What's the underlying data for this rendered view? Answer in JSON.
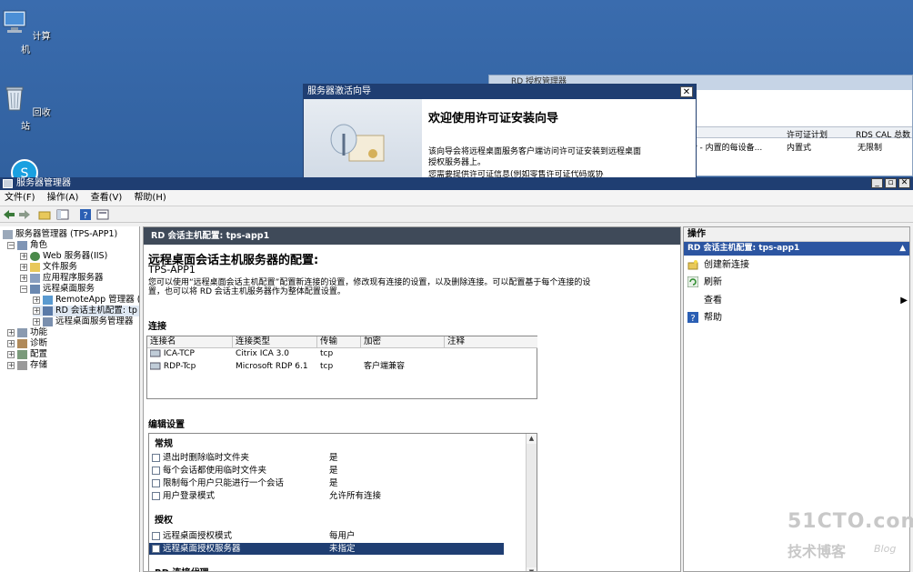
{
  "desktop": {
    "icons": [
      {
        "label": "计算机"
      },
      {
        "label": "回收站"
      }
    ]
  },
  "bg_window": {
    "title": "RD 授权管理器",
    "columns": [
      "许可证计划",
      "RDS CAL 总数"
    ],
    "row": {
      "product": "r - 内置的每设备...",
      "plan": "内置式",
      "total": "无限制"
    }
  },
  "wizard": {
    "title": "服务器激活向导",
    "heading": "欢迎使用许可证安装向导",
    "text": "该向导会将远程桌面服务客户端访问许可证安装到远程桌面授权服务器上。",
    "text2": "您需要提供许可证信息(例如零售许可证代码或协"
  },
  "main": {
    "title": "服务器管理器",
    "menu": [
      "文件(F)",
      "操作(A)",
      "查看(V)",
      "帮助(H)"
    ],
    "tree": [
      {
        "label": "服务器管理器 (TPS-APP1)",
        "indent": 0,
        "exp": ""
      },
      {
        "label": "角色",
        "indent": 1,
        "exp": "−"
      },
      {
        "label": "Web 服务器(IIS)",
        "indent": 2,
        "exp": "+"
      },
      {
        "label": "文件服务",
        "indent": 2,
        "exp": "+"
      },
      {
        "label": "应用程序服务器",
        "indent": 2,
        "exp": "+"
      },
      {
        "label": "远程桌面服务",
        "indent": 2,
        "exp": "−"
      },
      {
        "label": "RemoteApp 管理器 (",
        "indent": 3,
        "exp": "+"
      },
      {
        "label": "RD 会话主机配置: tp",
        "indent": 3,
        "exp": "+",
        "selected": true
      },
      {
        "label": "远程桌面服务管理器",
        "indent": 3,
        "exp": "+"
      },
      {
        "label": "功能",
        "indent": 1,
        "exp": "+"
      },
      {
        "label": "诊断",
        "indent": 1,
        "exp": "+"
      },
      {
        "label": "配置",
        "indent": 1,
        "exp": "+"
      },
      {
        "label": "存储",
        "indent": 1,
        "exp": "+"
      }
    ],
    "content": {
      "header": "RD 会话主机配置: tps-app1",
      "title": "远程桌面会话主机服务器的配置:",
      "server": "TPS-APP1",
      "description": "您可以使用“远程桌面会话主机配置”配置新连接的设置，修改现有连接的设置，以及删除连接。可以配置基于每个连接的设置，也可以将 RD 会话主机服务器作为整体配置设置。",
      "connections_label": "连接",
      "connection_columns": [
        "连接名",
        "连接类型",
        "传输",
        "加密",
        "注释"
      ],
      "connections": [
        {
          "name": "ICA-TCP",
          "type": "Citrix ICA 3.0",
          "transport": "tcp",
          "encryption": "",
          "comment": ""
        },
        {
          "name": "RDP-Tcp",
          "type": "Microsoft RDP 6.1",
          "transport": "tcp",
          "encryption": "客户端兼容",
          "comment": ""
        }
      ],
      "edit_label": "编辑设置",
      "group_general": "常规",
      "general": [
        {
          "label": "退出时删除临时文件夹",
          "value": "是"
        },
        {
          "label": "每个会话都使用临时文件夹",
          "value": "是"
        },
        {
          "label": "限制每个用户只能进行一个会话",
          "value": "是"
        },
        {
          "label": "用户登录模式",
          "value": "允许所有连接"
        }
      ],
      "group_licensing": "授权",
      "licensing": [
        {
          "label": "远程桌面授权模式",
          "value": "每用户"
        },
        {
          "label": "远程桌面授权服务器",
          "value": "未指定",
          "selected": true
        }
      ],
      "group_cut": "RD 连接代理"
    },
    "actions": {
      "header": "操作",
      "subheader": "RD 会话主机配置: tps-app1",
      "items": [
        {
          "label": "创建新连接"
        },
        {
          "label": "刷新"
        },
        {
          "label": "查看",
          "submenu": true
        },
        {
          "label": "帮助"
        }
      ]
    }
  },
  "watermark": {
    "brand": "51CTO.com",
    "sub": "技术博客",
    "blog": "Blog"
  }
}
